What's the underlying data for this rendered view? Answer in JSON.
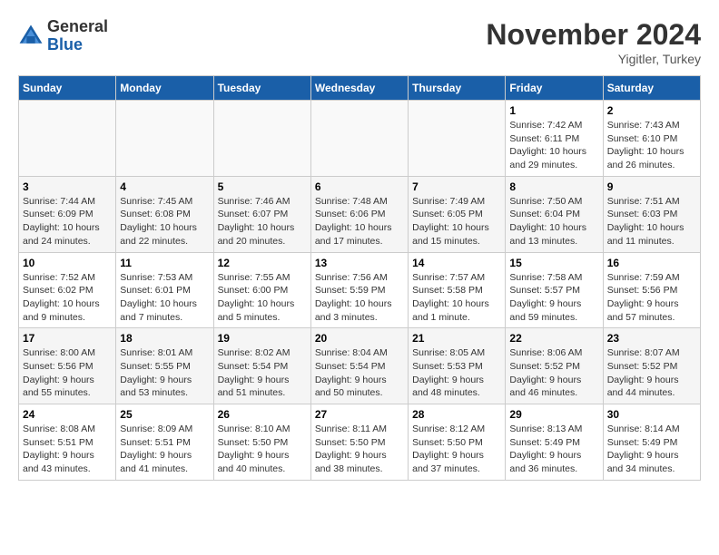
{
  "header": {
    "logo_general": "General",
    "logo_blue": "Blue",
    "month": "November 2024",
    "location": "Yigitler, Turkey"
  },
  "days_of_week": [
    "Sunday",
    "Monday",
    "Tuesday",
    "Wednesday",
    "Thursday",
    "Friday",
    "Saturday"
  ],
  "weeks": [
    {
      "shade": "light",
      "days": [
        {
          "num": "",
          "info": ""
        },
        {
          "num": "",
          "info": ""
        },
        {
          "num": "",
          "info": ""
        },
        {
          "num": "",
          "info": ""
        },
        {
          "num": "",
          "info": ""
        },
        {
          "num": "1",
          "info": "Sunrise: 7:42 AM\nSunset: 6:11 PM\nDaylight: 10 hours and 29 minutes."
        },
        {
          "num": "2",
          "info": "Sunrise: 7:43 AM\nSunset: 6:10 PM\nDaylight: 10 hours and 26 minutes."
        }
      ]
    },
    {
      "shade": "dark",
      "days": [
        {
          "num": "3",
          "info": "Sunrise: 7:44 AM\nSunset: 6:09 PM\nDaylight: 10 hours and 24 minutes."
        },
        {
          "num": "4",
          "info": "Sunrise: 7:45 AM\nSunset: 6:08 PM\nDaylight: 10 hours and 22 minutes."
        },
        {
          "num": "5",
          "info": "Sunrise: 7:46 AM\nSunset: 6:07 PM\nDaylight: 10 hours and 20 minutes."
        },
        {
          "num": "6",
          "info": "Sunrise: 7:48 AM\nSunset: 6:06 PM\nDaylight: 10 hours and 17 minutes."
        },
        {
          "num": "7",
          "info": "Sunrise: 7:49 AM\nSunset: 6:05 PM\nDaylight: 10 hours and 15 minutes."
        },
        {
          "num": "8",
          "info": "Sunrise: 7:50 AM\nSunset: 6:04 PM\nDaylight: 10 hours and 13 minutes."
        },
        {
          "num": "9",
          "info": "Sunrise: 7:51 AM\nSunset: 6:03 PM\nDaylight: 10 hours and 11 minutes."
        }
      ]
    },
    {
      "shade": "light",
      "days": [
        {
          "num": "10",
          "info": "Sunrise: 7:52 AM\nSunset: 6:02 PM\nDaylight: 10 hours and 9 minutes."
        },
        {
          "num": "11",
          "info": "Sunrise: 7:53 AM\nSunset: 6:01 PM\nDaylight: 10 hours and 7 minutes."
        },
        {
          "num": "12",
          "info": "Sunrise: 7:55 AM\nSunset: 6:00 PM\nDaylight: 10 hours and 5 minutes."
        },
        {
          "num": "13",
          "info": "Sunrise: 7:56 AM\nSunset: 5:59 PM\nDaylight: 10 hours and 3 minutes."
        },
        {
          "num": "14",
          "info": "Sunrise: 7:57 AM\nSunset: 5:58 PM\nDaylight: 10 hours and 1 minute."
        },
        {
          "num": "15",
          "info": "Sunrise: 7:58 AM\nSunset: 5:57 PM\nDaylight: 9 hours and 59 minutes."
        },
        {
          "num": "16",
          "info": "Sunrise: 7:59 AM\nSunset: 5:56 PM\nDaylight: 9 hours and 57 minutes."
        }
      ]
    },
    {
      "shade": "dark",
      "days": [
        {
          "num": "17",
          "info": "Sunrise: 8:00 AM\nSunset: 5:56 PM\nDaylight: 9 hours and 55 minutes."
        },
        {
          "num": "18",
          "info": "Sunrise: 8:01 AM\nSunset: 5:55 PM\nDaylight: 9 hours and 53 minutes."
        },
        {
          "num": "19",
          "info": "Sunrise: 8:02 AM\nSunset: 5:54 PM\nDaylight: 9 hours and 51 minutes."
        },
        {
          "num": "20",
          "info": "Sunrise: 8:04 AM\nSunset: 5:54 PM\nDaylight: 9 hours and 50 minutes."
        },
        {
          "num": "21",
          "info": "Sunrise: 8:05 AM\nSunset: 5:53 PM\nDaylight: 9 hours and 48 minutes."
        },
        {
          "num": "22",
          "info": "Sunrise: 8:06 AM\nSunset: 5:52 PM\nDaylight: 9 hours and 46 minutes."
        },
        {
          "num": "23",
          "info": "Sunrise: 8:07 AM\nSunset: 5:52 PM\nDaylight: 9 hours and 44 minutes."
        }
      ]
    },
    {
      "shade": "light",
      "days": [
        {
          "num": "24",
          "info": "Sunrise: 8:08 AM\nSunset: 5:51 PM\nDaylight: 9 hours and 43 minutes."
        },
        {
          "num": "25",
          "info": "Sunrise: 8:09 AM\nSunset: 5:51 PM\nDaylight: 9 hours and 41 minutes."
        },
        {
          "num": "26",
          "info": "Sunrise: 8:10 AM\nSunset: 5:50 PM\nDaylight: 9 hours and 40 minutes."
        },
        {
          "num": "27",
          "info": "Sunrise: 8:11 AM\nSunset: 5:50 PM\nDaylight: 9 hours and 38 minutes."
        },
        {
          "num": "28",
          "info": "Sunrise: 8:12 AM\nSunset: 5:50 PM\nDaylight: 9 hours and 37 minutes."
        },
        {
          "num": "29",
          "info": "Sunrise: 8:13 AM\nSunset: 5:49 PM\nDaylight: 9 hours and 36 minutes."
        },
        {
          "num": "30",
          "info": "Sunrise: 8:14 AM\nSunset: 5:49 PM\nDaylight: 9 hours and 34 minutes."
        }
      ]
    }
  ]
}
